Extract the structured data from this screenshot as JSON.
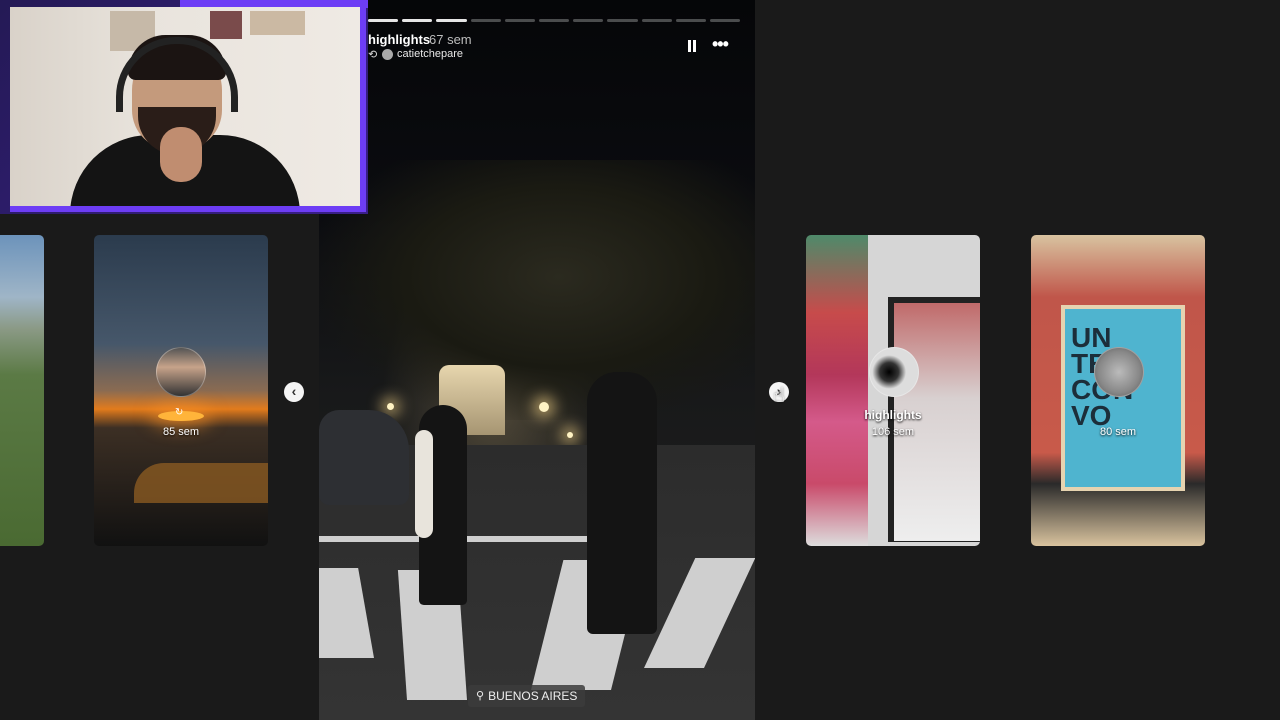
{
  "story": {
    "title": "highlights",
    "age": "67 sem",
    "author": "catietchepare",
    "location": "BUENOS AIRES",
    "progress_total": 11,
    "progress_done": 3
  },
  "icons": {
    "pause": "pause-icon",
    "more": "more-options-icon",
    "prev": "chevron-left-icon",
    "next": "chevron-right-icon",
    "location": "location-pin-icon",
    "repost": "repost-icon"
  },
  "previews": {
    "left_partial": {},
    "left": {
      "age": "85 sem"
    },
    "right1": {
      "title": "highlights",
      "age": "106 sem"
    },
    "right2": {
      "age": "80 sem"
    }
  },
  "colors": {
    "accent_webcam": "#6d3df5",
    "background": "#1a1a1a"
  }
}
